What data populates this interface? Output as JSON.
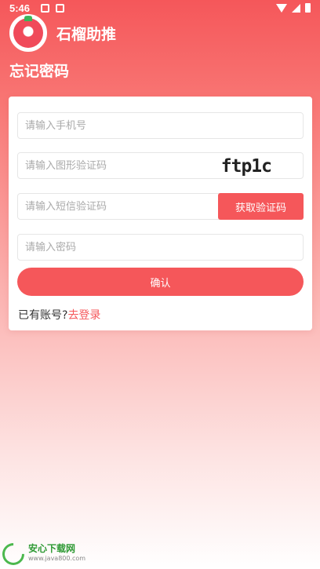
{
  "status_bar": {
    "time": "5:46"
  },
  "app": {
    "title": "石榴助推"
  },
  "page": {
    "title": "忘记密码"
  },
  "form": {
    "phone_placeholder": "请输入手机号",
    "graphic_code_placeholder": "请输入图形验证码",
    "captcha_text": "ftp1c",
    "sms_code_placeholder": "请输入短信验证码",
    "sms_button_label": "获取验证码",
    "password_placeholder": "请输入密码",
    "confirm_label": "确认",
    "have_account_text": "已有账号?",
    "login_link_label": "去登录"
  },
  "watermark": {
    "name": "安心下载网",
    "url": "www.java800.com"
  },
  "colors": {
    "accent": "#f5575a"
  }
}
